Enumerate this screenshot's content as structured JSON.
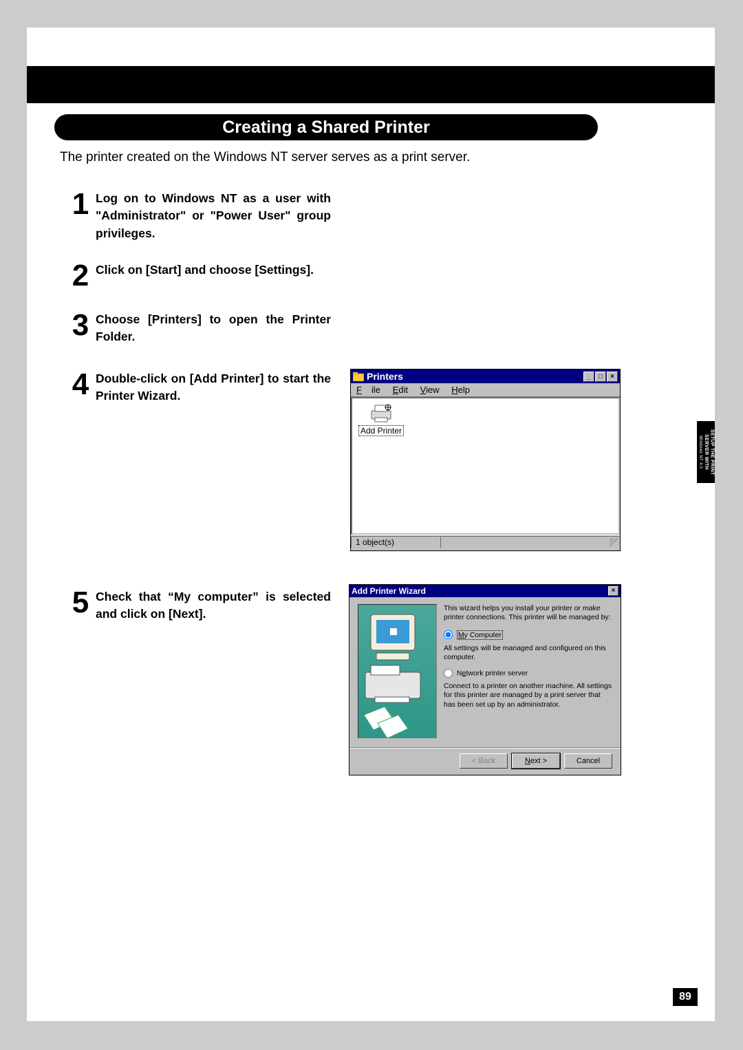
{
  "section_title": "Creating a Shared Printer",
  "intro": "The printer created on the Windows NT server serves as a print server.",
  "steps": [
    {
      "num": "1",
      "text": "Log on to Windows NT as a user with \"Administrator\" or \"Power User\" group privileges."
    },
    {
      "num": "2",
      "text": "Click on [Start] and choose [Settings]."
    },
    {
      "num": "3",
      "text": "Choose [Printers] to open the Printer Folder."
    },
    {
      "num": "4",
      "text": "Double-click on [Add Printer] to start the Printer Wizard."
    },
    {
      "num": "5",
      "text": "Check that “My computer” is selected and click on [Next]."
    }
  ],
  "printers_window": {
    "title": "Printers",
    "menu": {
      "file": "File",
      "edit": "Edit",
      "view": "View",
      "help": "Help"
    },
    "add_printer_label": "Add Printer",
    "status": "1 object(s)",
    "min": "_",
    "max": "□",
    "close": "×"
  },
  "wizard": {
    "title": "Add Printer Wizard",
    "close": "×",
    "intro": "This wizard helps you install your printer or make printer connections.  This printer will be managed by:",
    "opt1_label": "My Computer",
    "opt1_desc": "All settings will be managed and configured on this computer.",
    "opt2_label": "Network printer server",
    "opt2_desc": "Connect to a printer on another machine.  All settings for this printer are managed by a print server that has been set up by an administrator.",
    "btn_back": "< Back",
    "btn_next": "Next >",
    "btn_cancel": "Cancel"
  },
  "side_tab": {
    "line1": "SETUP THE PRINT",
    "line2": "SERVER WITH",
    "line3": "Windows NT 4.0"
  },
  "page_number": "89"
}
